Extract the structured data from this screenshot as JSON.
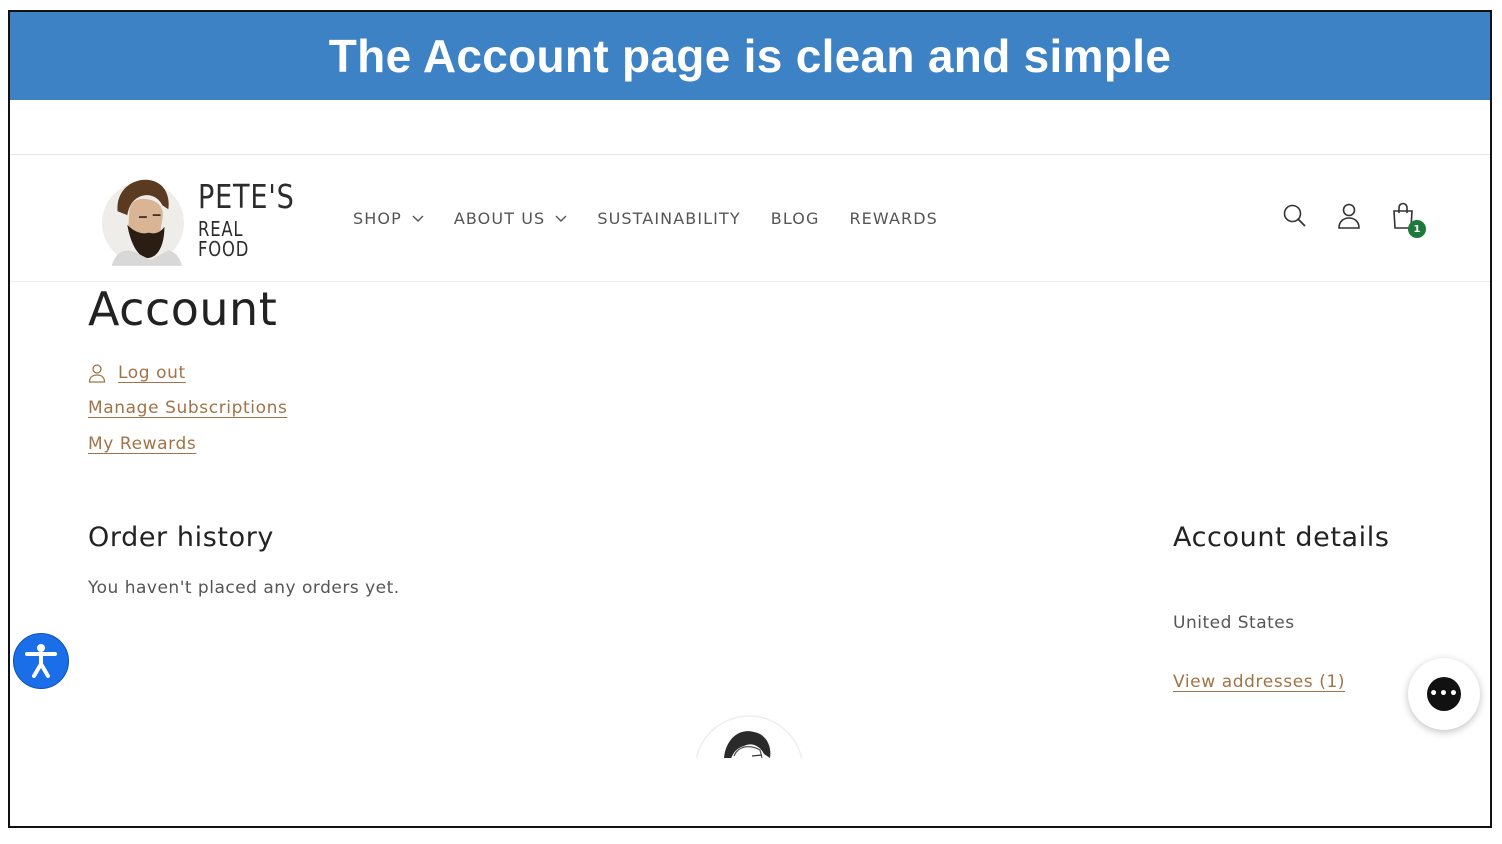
{
  "banner": {
    "text": "The Account page is clean and simple"
  },
  "brand": {
    "line1": "PETE'S",
    "line2": "REAL FOOD",
    "logo_icon": "bearded-man-portrait"
  },
  "nav": {
    "items": [
      {
        "label": "SHOP",
        "has_dropdown": true
      },
      {
        "label": "ABOUT US",
        "has_dropdown": true
      },
      {
        "label": "SUSTAINABILITY",
        "has_dropdown": false
      },
      {
        "label": "BLOG",
        "has_dropdown": false
      },
      {
        "label": "REWARDS",
        "has_dropdown": false
      }
    ]
  },
  "header_icons": {
    "search": "search-icon",
    "account": "account-icon",
    "cart": "cart-icon",
    "cart_count": "1"
  },
  "page": {
    "title": "Account",
    "logout": "Log out",
    "manage_subscriptions": "Manage Subscriptions",
    "my_rewards": "My Rewards"
  },
  "order_history": {
    "title": "Order history",
    "empty_text": "You haven't placed any orders yet."
  },
  "account_details": {
    "title": "Account details",
    "country": "United States",
    "view_addresses": "View addresses (1)"
  },
  "colors": {
    "banner": "#3e82c6",
    "link": "#a27346",
    "accessibility": "#1a6ee8",
    "badge": "#1e7a3a"
  },
  "widgets": {
    "accessibility": "accessibility-icon",
    "chat": "chat-icon"
  }
}
